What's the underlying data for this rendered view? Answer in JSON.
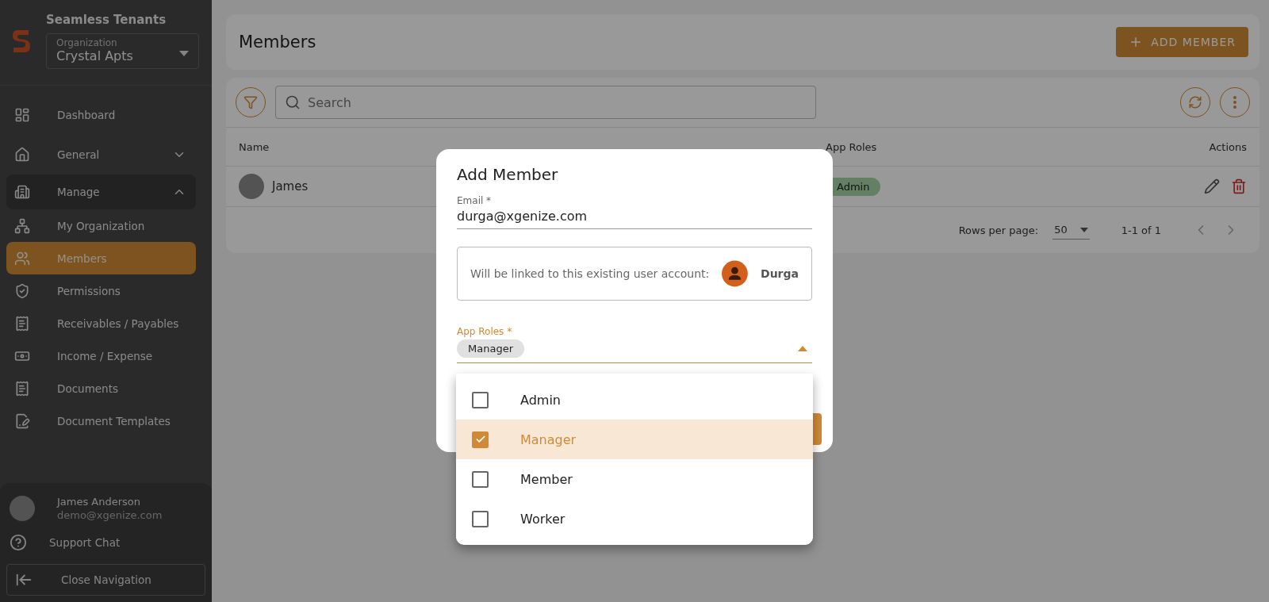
{
  "app": {
    "name": "Seamless Tenants",
    "organization_label": "Organization",
    "organization": "Crystal Apts"
  },
  "nav": [
    {
      "label": "Dashboard",
      "selected": false
    },
    {
      "label": "General",
      "selected": false,
      "expanded": false
    },
    {
      "label": "Manage",
      "selected": false,
      "expanded": true,
      "children": [
        {
          "label": "My Organization",
          "selected": false
        },
        {
          "label": "Members",
          "selected": true
        },
        {
          "label": "Permissions",
          "selected": false
        },
        {
          "label": "Receivables / Payables",
          "selected": false
        },
        {
          "label": "Income / Expense",
          "selected": false
        },
        {
          "label": "Documents",
          "selected": false
        },
        {
          "label": "Document Templates",
          "selected": false
        }
      ]
    }
  ],
  "user": {
    "name": "James Anderson",
    "email": "demo@xgenize.com"
  },
  "support": "Support Chat",
  "close_nav": "Close Navigation",
  "page": {
    "title": "Members",
    "add_button": "ADD MEMBER"
  },
  "search": {
    "placeholder": "Search"
  },
  "table": {
    "columns": [
      "Name",
      "App Roles",
      "Actions"
    ],
    "rows": [
      {
        "name": "James",
        "role": "Admin"
      }
    ]
  },
  "pagination": {
    "rows_label": "Rows per page:",
    "rows_value": "50",
    "range": "1-1 of 1"
  },
  "dialog": {
    "title": "Add Member",
    "email_label": "Email *",
    "email": "durga@xgenize.com",
    "link_text": "Will be linked to this existing user account:",
    "linked_user": "Durga",
    "roles_label": "App Roles *",
    "roles_chips": [
      "Manager"
    ],
    "options": [
      {
        "label": "Admin",
        "checked": false,
        "selected": false
      },
      {
        "label": "Manager",
        "checked": true,
        "selected": true
      },
      {
        "label": "Member",
        "checked": false,
        "selected": false
      },
      {
        "label": "Worker",
        "checked": false,
        "selected": false
      }
    ]
  }
}
